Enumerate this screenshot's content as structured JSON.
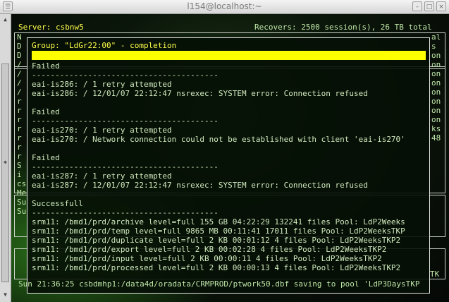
{
  "window": {
    "title": "l154@localhost:~"
  },
  "server_line": {
    "left": "Server: csbnw5",
    "right": "Recovers: 2500 session(s), 26 TB total"
  },
  "left_edge": [
    "N",
    "D",
    "",
    "",
    "",
    "D",
    "/",
    "/",
    "/",
    "/",
    "r",
    "r",
    "r",
    "r",
    "r",
    "r",
    "r",
    "",
    "",
    "S",
    "i",
    "cs",
    "",
    "",
    "Me",
    "Su",
    "Su"
  ],
  "right_edge": [
    "al",
    "s",
    "",
    "",
    "",
    "",
    "",
    "",
    "",
    "",
    "on",
    "on",
    "on",
    "on",
    "on",
    "on",
    "on",
    "",
    "",
    "on",
    "ks",
    "48",
    "",
    "",
    "",
    "",
    ""
  ],
  "popup": {
    "title": "Group: \"LdGr22:00\" - completion",
    "lines": [
      "Failed",
      "----------------------------------------",
      "eai-is286: / 1 retry attempted",
      "eai-is286: / 12/01/07 22:12:47 nsrexec: SYSTEM error: Connection refused",
      "",
      "Failed",
      "----------------------------------------",
      "eai-is270: / 1 retry attempted",
      "eai-is270: / Network connection could not be established with client 'eai-is270'",
      "",
      "Failed",
      "----------------------------------------",
      "eai-is287: / 1 retry attempted",
      "eai-is287: / 12/01/07 22:12:47 nsrexec: SYSTEM error: Connection refused",
      "",
      "Successfull",
      "----------------------------------------",
      "srm11: /bmd1/prd/archive level=full 155 GB 04:22:29 132241 files Pool: LdP2Weeks",
      "srm11: /bmd1/prd/temp level=full 9865 MB 00:11:41 17011 files Pool: LdP2WeeksTKP",
      "srm11: /bmd1/prd/duplicate level=full 2 KB 00:01:12 4 files Pool: LdP2WeeksTKP2",
      "srm11: /bmd1/prd/export level=full 2 KB 00:02:28 4 files Pool: LdP2WeeksTKP2",
      "srm11: /bmd1/prd/input level=full 2 KB 00:00:11 4 files Pool: LdP2WeeksTKP2",
      "srm11: /bmd1/prd/processed level=full 2 KB 00:00:13 4 files Pool: LdP2WeeksTKP2"
    ],
    "corner": "TK"
  },
  "status_line": "Sun 21:36:25 csbdmhp1:/data4d/oradata/CRMPROD/ptwork50.dbf saving to pool 'LdP3DaysTKP"
}
